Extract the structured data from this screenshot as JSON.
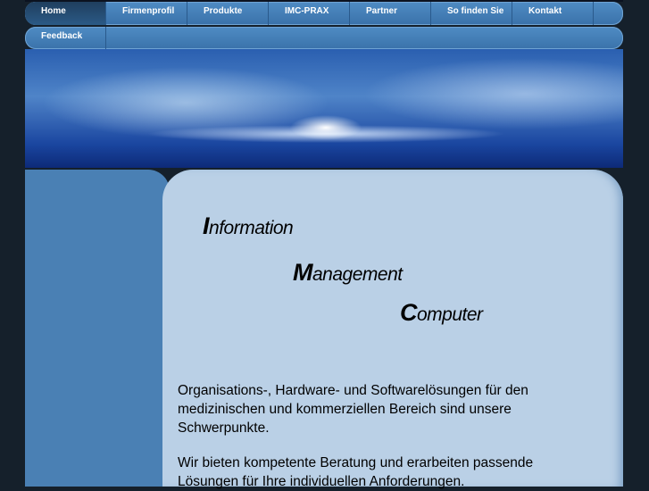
{
  "nav": {
    "row1": [
      "Home",
      "Firmenprofil",
      "Produkte",
      "IMC-PRAX",
      "Partner",
      "So finden Sie",
      "Kontakt"
    ],
    "row2": [
      "Feedback"
    ],
    "active": "Home"
  },
  "title": {
    "w1_initial": "I",
    "w1_rest": "nformation",
    "w2_initial": "M",
    "w2_rest": "anagement",
    "w3_initial": "C",
    "w3_rest": "omputer"
  },
  "content": {
    "p1": "Organisations-, Hardware- und Softwarelösungen für den medizinischen und kommerziellen Bereich sind unsere Schwerpunkte.",
    "p2": "Wir bieten kompetente Beratung und erarbeiten passende Lösungen für Ihre individuellen Anforderungen."
  }
}
